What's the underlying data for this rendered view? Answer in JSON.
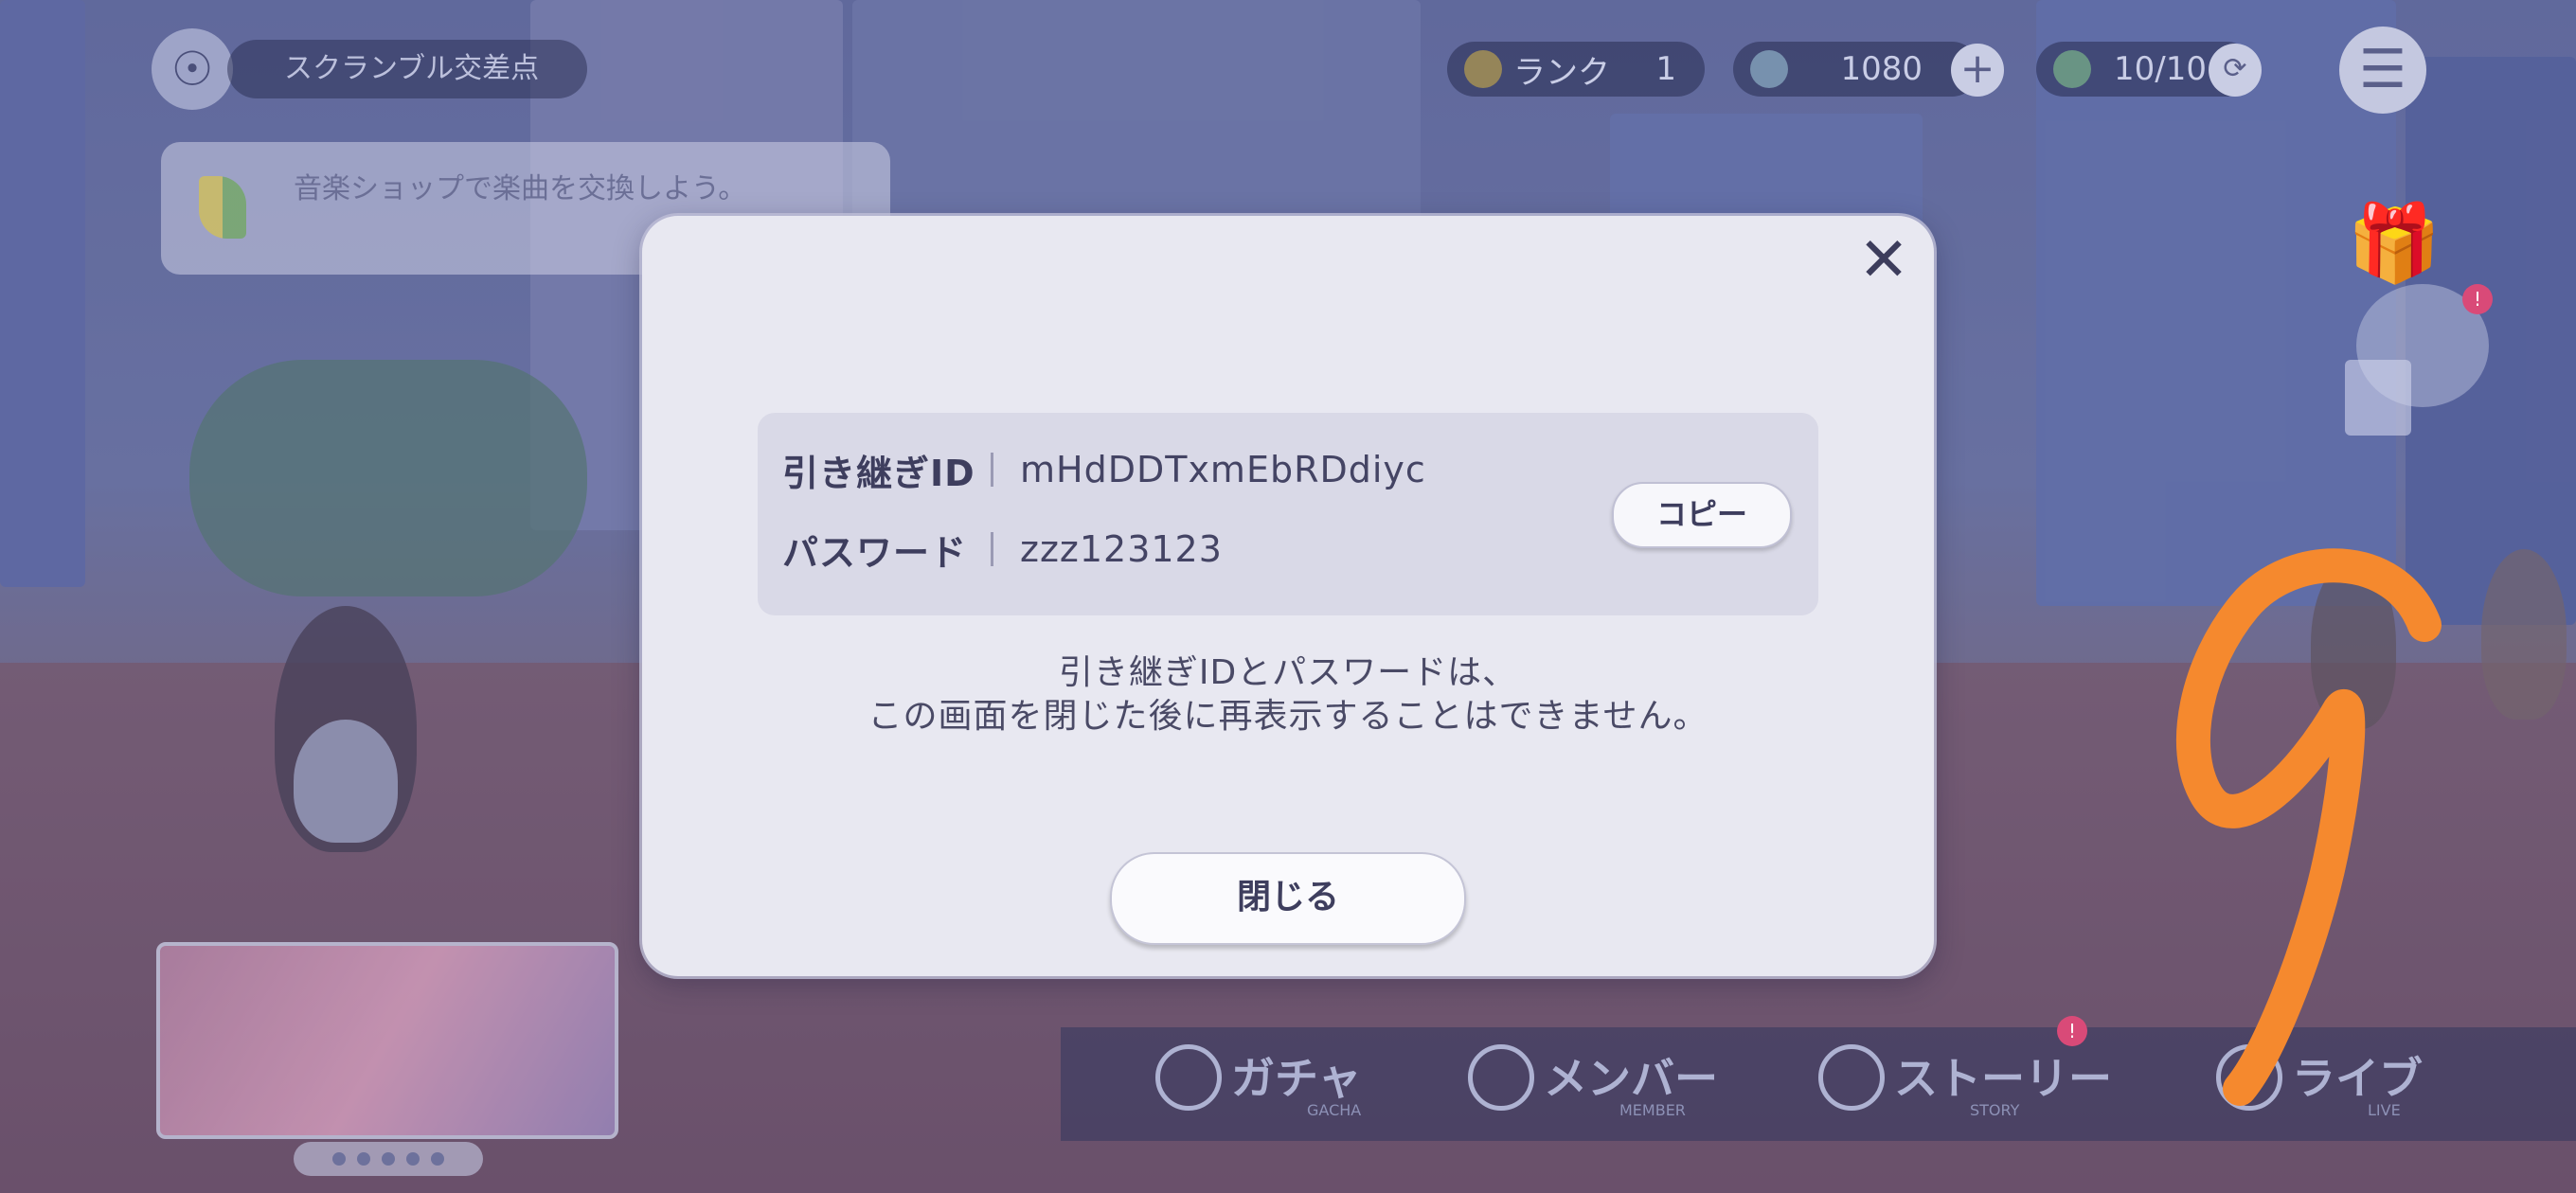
{
  "hud": {
    "location": "スクランブル交差点",
    "rank_label": "ランク",
    "rank_value": "1",
    "currency_value": "1080",
    "stamina_value": "10/10"
  },
  "mission": {
    "text": "音楽ショップで楽曲を交換しよう。"
  },
  "nav": {
    "gacha": {
      "label": "ガチャ",
      "sub": "GACHA"
    },
    "member": {
      "label": "メンバー",
      "sub": "MEMBER"
    },
    "story": {
      "label": "ストーリー",
      "sub": "STORY"
    },
    "live": {
      "label": "ライブ",
      "sub": "LIVE"
    }
  },
  "dialog": {
    "id_label": "引き継ぎID",
    "id_value": "mHdDDTxmEbRDdiyc",
    "password_label": "パスワード",
    "password_value": "zzz123123",
    "copy_label": "コピー",
    "note_line1": "引き継ぎIDとパスワードは、",
    "note_line2": "この画面を閉じた後に再表示することはできません。",
    "close_label": "閉じる",
    "close_icon": "close-icon"
  },
  "annotation": {
    "color": "#f5892e"
  }
}
